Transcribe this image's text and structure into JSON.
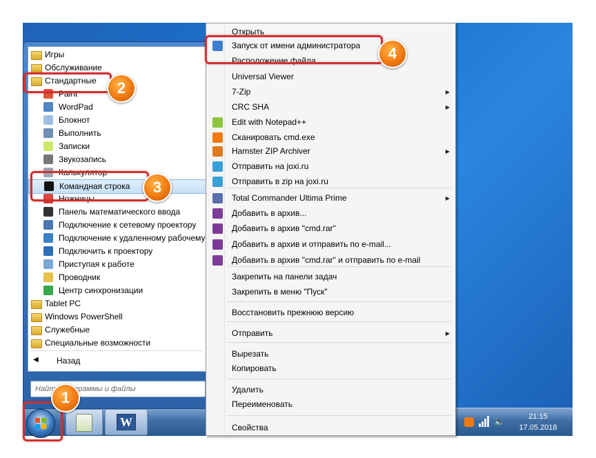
{
  "start_menu": {
    "programs": [
      {
        "label": "Игры",
        "kind": "folder",
        "selected": false
      },
      {
        "label": "Обслуживание",
        "kind": "folder",
        "selected": false
      },
      {
        "label": "Стандартные",
        "kind": "folder",
        "selected": false
      },
      {
        "label": "Paint",
        "kind": "app",
        "icon": "paint-icon",
        "selected": false
      },
      {
        "label": "WordPad",
        "kind": "app",
        "icon": "wordpad-icon",
        "selected": false
      },
      {
        "label": "Блокнот",
        "kind": "app",
        "icon": "notepad-icon",
        "selected": false
      },
      {
        "label": "Выполнить",
        "kind": "app",
        "icon": "run-icon",
        "selected": false
      },
      {
        "label": "Записки",
        "kind": "app",
        "icon": "sticky-notes-icon",
        "selected": false
      },
      {
        "label": "Звукозапись",
        "kind": "app",
        "icon": "microphone-icon",
        "selected": false
      },
      {
        "label": "Калькулятор",
        "kind": "app",
        "icon": "calculator-icon",
        "selected": false
      },
      {
        "label": "Командная строка",
        "kind": "app",
        "icon": "cmd-icon",
        "selected": true
      },
      {
        "label": "Ножницы",
        "kind": "app",
        "icon": "scissors-icon",
        "selected": false
      },
      {
        "label": "Панель математического ввода",
        "kind": "app",
        "icon": "math-input-icon",
        "selected": false
      },
      {
        "label": "Подключение к сетевому проектору",
        "kind": "app",
        "icon": "network-projector-icon",
        "selected": false
      },
      {
        "label": "Подключение к удаленному рабочему",
        "kind": "app",
        "icon": "remote-desktop-icon",
        "selected": false
      },
      {
        "label": "Подключить к проектору",
        "kind": "app",
        "icon": "projector-icon",
        "selected": false
      },
      {
        "label": "Приступая к работе",
        "kind": "app",
        "icon": "getting-started-icon",
        "selected": false
      },
      {
        "label": "Проводник",
        "kind": "app",
        "icon": "explorer-folder-icon",
        "selected": false
      },
      {
        "label": "Центр синхронизации",
        "kind": "app",
        "icon": "sync-center-icon",
        "selected": false
      },
      {
        "label": "Tablet PC",
        "kind": "folder",
        "selected": false
      },
      {
        "label": "Windows PowerShell",
        "kind": "folder",
        "selected": false
      },
      {
        "label": "Служебные",
        "kind": "folder",
        "selected": false
      },
      {
        "label": "Специальные возможности",
        "kind": "folder",
        "selected": false
      }
    ],
    "back_label": "Назад",
    "search_placeholder": "Найти программы и файлы"
  },
  "context_menu": {
    "items": [
      {
        "label": "Открыть",
        "icon": "",
        "submenu": false
      },
      {
        "label": "Запуск от имени администратора",
        "icon": "shield-icon",
        "submenu": false
      },
      {
        "label": "Расположение файла",
        "icon": "",
        "submenu": false
      },
      {
        "label": "Universal Viewer",
        "icon": "",
        "submenu": false
      },
      {
        "label": "7-Zip",
        "icon": "",
        "submenu": true
      },
      {
        "label": "CRC SHA",
        "icon": "",
        "submenu": true
      },
      {
        "label": "Edit with Notepad++",
        "icon": "notepadpp-icon",
        "submenu": false
      },
      {
        "label": "Сканировать cmd.exe",
        "icon": "avast-icon",
        "submenu": false
      },
      {
        "label": "Hamster ZIP Archiver",
        "icon": "hamster-icon",
        "submenu": true
      },
      {
        "label": "Отправить на joxi.ru",
        "icon": "joxi-icon",
        "submenu": false
      },
      {
        "label": "Отправить в zip на joxi.ru",
        "icon": "joxi-icon",
        "submenu": false
      },
      {
        "label": "Total Commander Ultima Prime",
        "icon": "total-commander-icon",
        "submenu": true
      },
      {
        "label": "Добавить в архив...",
        "icon": "winrar-icon",
        "submenu": false
      },
      {
        "label": "Добавить в архив \"cmd.rar\"",
        "icon": "winrar-icon",
        "submenu": false
      },
      {
        "label": "Добавить в архив и отправить по e-mail...",
        "icon": "winrar-icon",
        "submenu": false
      },
      {
        "label": "Добавить в архив \"cmd.rar\" и отправить по e-mail",
        "icon": "winrar-icon",
        "submenu": false
      },
      {
        "label": "Закрепить на панели задач",
        "icon": "",
        "submenu": false
      },
      {
        "label": "Закрепить в меню \"Пуск\"",
        "icon": "",
        "submenu": false
      },
      {
        "label": "Восстановить прежнюю версию",
        "icon": "",
        "submenu": false
      },
      {
        "label": "Отправить",
        "icon": "",
        "submenu": true
      },
      {
        "label": "Вырезать",
        "icon": "",
        "submenu": false
      },
      {
        "label": "Копировать",
        "icon": "",
        "submenu": false
      },
      {
        "label": "Удалить",
        "icon": "",
        "submenu": false
      },
      {
        "label": "Переименовать",
        "icon": "",
        "submenu": false
      },
      {
        "label": "Свойства",
        "icon": "",
        "submenu": false
      }
    ]
  },
  "taskbar": {
    "word_label": "W",
    "time": "21:15",
    "date": "17.05.2018"
  },
  "callouts": [
    {
      "number": "1"
    },
    {
      "number": "2"
    },
    {
      "number": "3"
    },
    {
      "number": "4"
    }
  ],
  "colors": {
    "callout_border": "#d32f2f",
    "callout_badge": "#f07a12",
    "desktop": "#1f6fc5"
  }
}
